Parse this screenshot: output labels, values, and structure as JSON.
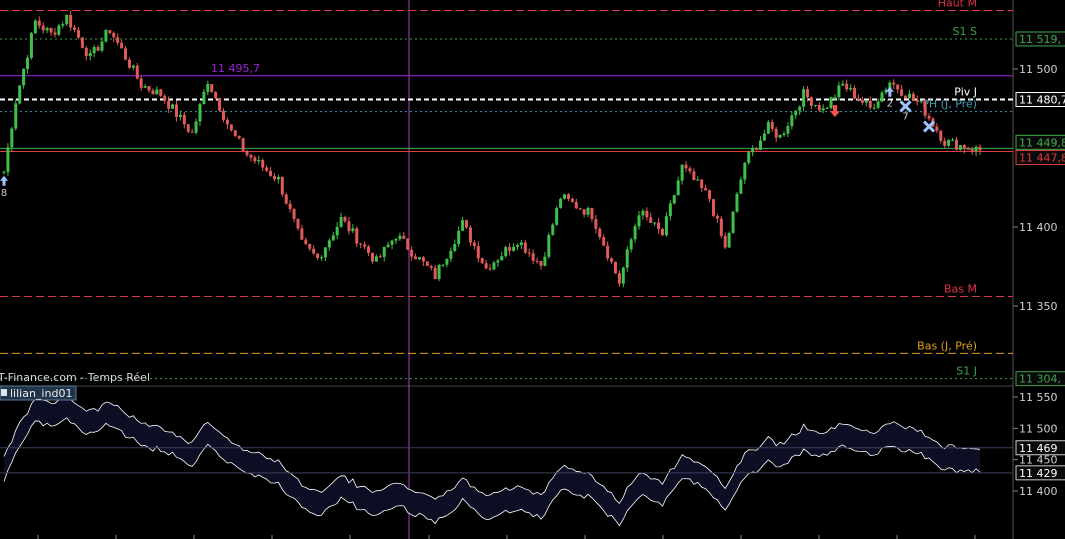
{
  "chart_data": [
    {
      "type": "line",
      "title": "T-Finance.com - Temps Réel",
      "ylim": [
        11328,
        11542
      ],
      "y_ticks": [
        11350,
        11400,
        11500
      ],
      "y_tick_labels": [
        "11 350",
        "11 400",
        "11 500"
      ],
      "grid": false,
      "price_series": {
        "name": "",
        "anchors_x_index": [
          0,
          3,
          8,
          12,
          16,
          22,
          27,
          35,
          40,
          48,
          52,
          58,
          62,
          70,
          76,
          80,
          86,
          95,
          100,
          110,
          117,
          123,
          131,
          137,
          142,
          150,
          157,
          162,
          168,
          173,
          180,
          184,
          189,
          195,
          198,
          204,
          209,
          214,
          221,
          226,
          234,
          240,
          250
        ],
        "anchors_values": [
          11435,
          11480,
          11530,
          11522,
          11533,
          11507,
          11525,
          11490,
          11484,
          11459,
          11493,
          11460,
          11446,
          11430,
          11389,
          11380,
          11405,
          11378,
          11395,
          11369,
          11402,
          11374,
          11392,
          11376,
          11419,
          11408,
          11365,
          11410,
          11395,
          11438,
          11418,
          11386,
          11441,
          11463,
          11457,
          11484,
          11474,
          11490,
          11475,
          11492,
          11477,
          11454,
          11448
        ]
      },
      "levels": [
        {
          "label": "Haut M",
          "value": 11537,
          "color": "#e0304a",
          "style": "dashed"
        },
        {
          "label": "S1 S",
          "value": 11519,
          "value_label": "11 519,",
          "color": "#3fa34a",
          "style": "dotted"
        },
        {
          "label": "11 495,7",
          "value": 11495.7,
          "color": "#a020e0",
          "style": "solid"
        },
        {
          "label": "Piv J",
          "value": 11480.7,
          "value_label": "11 480,7",
          "color": "#ffffff",
          "style": "dashed"
        },
        {
          "label": "PH (J, Pré)",
          "value": 11473,
          "color": "#3a9bb3",
          "style": "dotted"
        },
        {
          "label": "",
          "value": 11449.8,
          "value_label": "11 449,8",
          "color": "#3fb04a",
          "style": "solid"
        },
        {
          "label": "",
          "value": 11447.8,
          "value_label": "11 447,8",
          "color": "#e03b3b",
          "style": "solid"
        },
        {
          "label": "Bas M",
          "value": 11356,
          "color": "#e0304a",
          "style": "dashed"
        },
        {
          "label": "Bas (J, Pré)",
          "value": 11320,
          "color": "#e0a020",
          "style": "dashed"
        },
        {
          "label": "S1 J",
          "value": 11304,
          "value_label": "11 304,",
          "color": "#3fa34a",
          "style": "dotted"
        }
      ],
      "markers": [
        {
          "kind": "up-arrow",
          "x_index": 0,
          "label": "8"
        },
        {
          "kind": "down-arrow",
          "x_index": 212,
          "label": ""
        },
        {
          "kind": "up-arrow",
          "x_index": 226,
          "label": "2"
        },
        {
          "kind": "cross",
          "x_index": 230,
          "label": "7"
        },
        {
          "kind": "cross",
          "x_index": 236,
          "label": ""
        }
      ],
      "colors": {
        "up": "#3fc04a",
        "down": "#e05a5a",
        "axis_text": "#d0d0d0",
        "cursor": "#b040c0"
      }
    },
    {
      "type": "area",
      "title": "lilian_ind01",
      "ylim": [
        11360,
        11575
      ],
      "y_ticks": [
        11400,
        11450,
        11500,
        11550
      ],
      "y_tick_labels": [
        "11 400",
        "11 450",
        "11 500",
        "11 550"
      ],
      "current_labels": [
        {
          "value": 11469,
          "text": "11 469"
        },
        {
          "value": 11429,
          "text": "11 429"
        }
      ],
      "band": {
        "upper_offset": 18,
        "lower_offset": -18,
        "fill": "#0c0f24",
        "line": "#ffffff"
      }
    }
  ]
}
